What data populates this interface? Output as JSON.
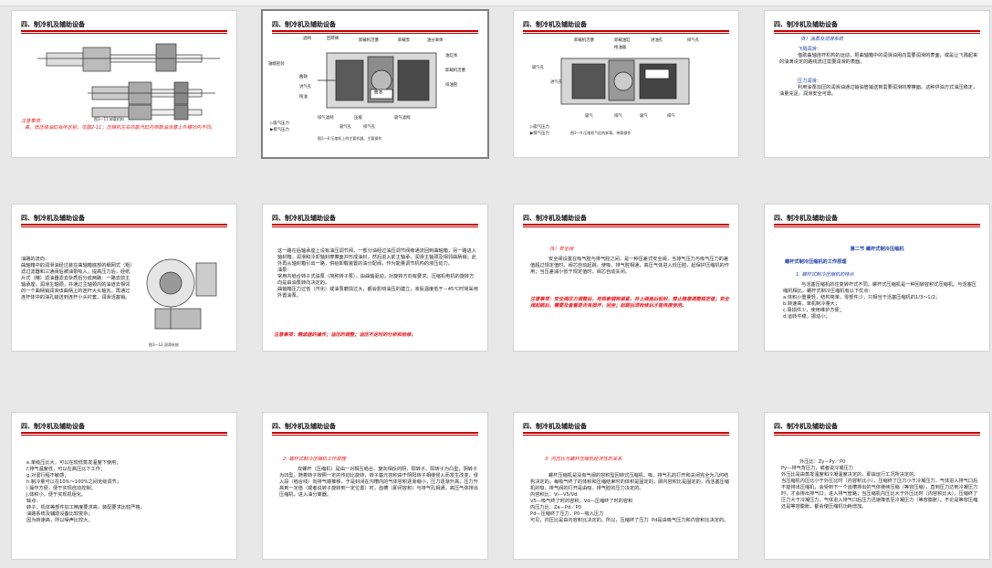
{
  "header": "四、制冷机及辅助设备",
  "slide1": {
    "caption": "图3—11  卸载机构",
    "note_title": "注意事项：",
    "note_body": "高、低压级油缸有所区别，见图2-11；压缩机左右均能汽缸内侧数油活塞上外槽功内不同。"
  },
  "slide2": {
    "labels": [
      "滤网",
      "回转阀",
      "卸载机活塞",
      "卸载泵",
      "油分离体"
    ],
    "left_labels": [
      "轴端密封",
      "曲轴",
      "进气孔",
      "拖油"
    ],
    "right_labels": [
      "油缸体",
      "卸载机活塞",
      "排油管"
    ],
    "bottom_labels": [
      "排气滤网",
      "压缩",
      "吸气滤网",
      "吸气孔",
      "排气孔"
    ],
    "legend": [
      "▷吸气压力",
      "▶排气压力"
    ],
    "caption": "图3—8  压缩机上的主要机器、主要操作",
    "center_label": "曲油"
  },
  "slide3": {
    "labels": [
      "卸载机活塞",
      "卸载油缸",
      "进油孔",
      "排气孔",
      "拖油器"
    ],
    "left_labels": [
      "吸气孔",
      "进气孔"
    ],
    "bottom_labels": [
      "吸气",
      "排气",
      "吸气",
      "排气"
    ],
    "legend": [
      "▷吸气压力",
      "▶排气压力"
    ],
    "caption": "图3—9  压缩机气缸的卸载、带载操作"
  },
  "slide4": {
    "title": "（8）油泵及润滑系统",
    "sub1": "飞溅润滑：",
    "body1": "借助曲轴连杆机构的运动，把曲轴箱中的润滑油甩向需要润滑的表面，或是让飞溅起来的油滴设定的路线流过需要润滑的表面。",
    "sub2": "压力润滑：",
    "body2": "利用油泵加压的润滑油通过输油管输送到需要润滑的摩擦面。这种供油方式油压稳定，油量充足，润滑安全可靠。"
  },
  "slide5": {
    "body": "油路的流向：\n曲轴箱中的润滑油经过装在曲轴箱底部的细网式（粗）滤过滤器和三通阀后被油泵吸入，提高压力后，经纸片式（精）滤油器滤去杂质后分成两路：一路去前主轴承座，润滑主轴颈，并通过主轴颈内的油道去相邻的一个曲柄销润滑该曲柄上的连杆大头轴瓦，再通过连杆体中的油孔输送到连杆小头衬套，润滑活塞销。",
    "caption": "图3—12  润滑系统"
  },
  "slide6": {
    "body": "这一路在后轴承座上设有油压调节阀，一部分油经过油压调节阀旁通流回到曲轴箱；另一路进入轴封箱，润滑和冷却轴封摩擦面并形成油封，然后进入前主轴承，润滑主轴颈及相邻曲柄销；此外再从轴封箱引出一路，供给卸载装置的油分配阀，作为能量调节机构的液压动力。\n油泵：\n常用内啮合转子式油泵（简称转子泵），由曲轴驱动，对旋转方向有要求。压缩机电机的旋转方向是由油泵转向决定的。\n曲轴箱压力过低（汽化）或油泵磨损过大，都会影响油压的建立，液氨温度低于－45℃时常采用外置油泵。",
    "note": "注意事项：精滤器的操作；油压的调整；油压不足时的分析和检修。"
  },
  "slide7": {
    "title": "（9）安全阀",
    "body": "安全阀设置在吸气腔与排气腔之间，是一种压差式安全阀，当排气压力与吸气压力的差值超过规定值时，阀芯自动起跳，使吸、排气腔相通，高压气体进入低压腔，起保护压缩机的作用；当压差减小低于规定值时，阀芯自动关闭。",
    "note": "注意事项：安全阀压力调整后，用铁索锚钩锁紧，并上阀盖后铅封，禁止随意调整规定值；安全阀起跳后，需要及查看是否有损坏，回坐；起跳后须检修后才能再度使用。"
  },
  "slide8": {
    "title": "第二节  螺杆式制冷压缩机",
    "subtitle": "螺杆式制冷压缩机的工作原理",
    "h1": "1. 螺杆式制冷压缩机的特点",
    "body": "与活塞压缩机的往复转杆式不同，螺杆式压缩机是一种回转容积式压缩机。与活塞压缩机相比，螺杆式制冷压缩机有以下优点：\na.体积小重量轻，结构简单，零部件少，只相当于活塞压缩机的1/3～1/2；\nb.转速高，单机制冷量大；\nc.易损件少，使用维护方便；\nd.运转平稳，振动小；"
  },
  "slide9": {
    "body": "e.单级压比大，可以在较低蒸发温度下使用；\nf.排气温度低，可以在高压比下工作；\ng.对湿行程不敏感；\nh.制冷量可以在10%～100%之间无级调节；\ni.操作方便，便于实现自动控制；\nj.体积小，便于实现机组化。\n缺点：\n转子、机体等部件加工精度要求高，装配要求比较严格；\n油路系统及辅助设备比较复杂；\n因为转速高，所以噪声比较大。"
  },
  "slide10": {
    "title": "2. 螺杆式制冷压缩机工作原理",
    "body": "双螺杆（压缩机）是由一对相互啮合、旋向相反的阴、阳转子、阳转子为凸型，阴转子为凹型。随着转子按照一定的传动比旋转，转子基元容积由于阴阳转子相继侵入而发生改变，侵入段（啮合线）向排气端推移，于是封闭在沟槽内的气体容积逐渐缩小，压力逐渐升高，压力升高到一定值（或者说转子旋转到一定位置）时，齿槽（即闭容积）与排气孔相通，高压气体排出压缩机，进入油分离器。"
  },
  "slide11": {
    "title": "3. 内压比与螺杆压缩机经济性的关系",
    "body": "螺杆压缩机是没有气阀的容积型回转式压缩机，吸、排气孔的打开和关闭完全为几何结构决定的，每吸气终了的体积和压缩结束时的体积是固定的，即内容积比是固定的，而活塞压缩机的吸、排气阀的打开是由吸、排气腔的压力决定的。\n内容积比：Vi—V5/Vd\nV5—吸气终了时的容积，Vd—压缩终了时的容积\n内压力比：Za－Pd／P0\nPd—压缩终了压力，P0—吸入压力\n可见，内压比是由内容积比决定的。所以，压缩终了压力  Pd是由吸气压力和内容积比决定的。"
  },
  "slide12": {
    "body": "外压比：Zy－Py／P0\nPy—排气背压力，或者说冷凝压力\n外压比是由蒸发温度和冷凝温度决定的，即由运行工况所决定的。\n当压缩机内压比小于外压比时（内容积比小），压缩终了压力小于冷凝压力，气体进入排气口后不能排出压缩机，会受到下一个齿槽排出的气体继续压缩（等容压缩），直到压力达到冷凝压力时，才会排出排气口，进入排气管路；当压缩机内压比大于外压比时（内容积比大），压缩终了压力大于冷凝压力，气体进入排气口后压力迅速降低至冷凝压力（等容膨胀）。不论是等容压缩还是等容膨胀，都会使压缩机功耗增加。"
  }
}
